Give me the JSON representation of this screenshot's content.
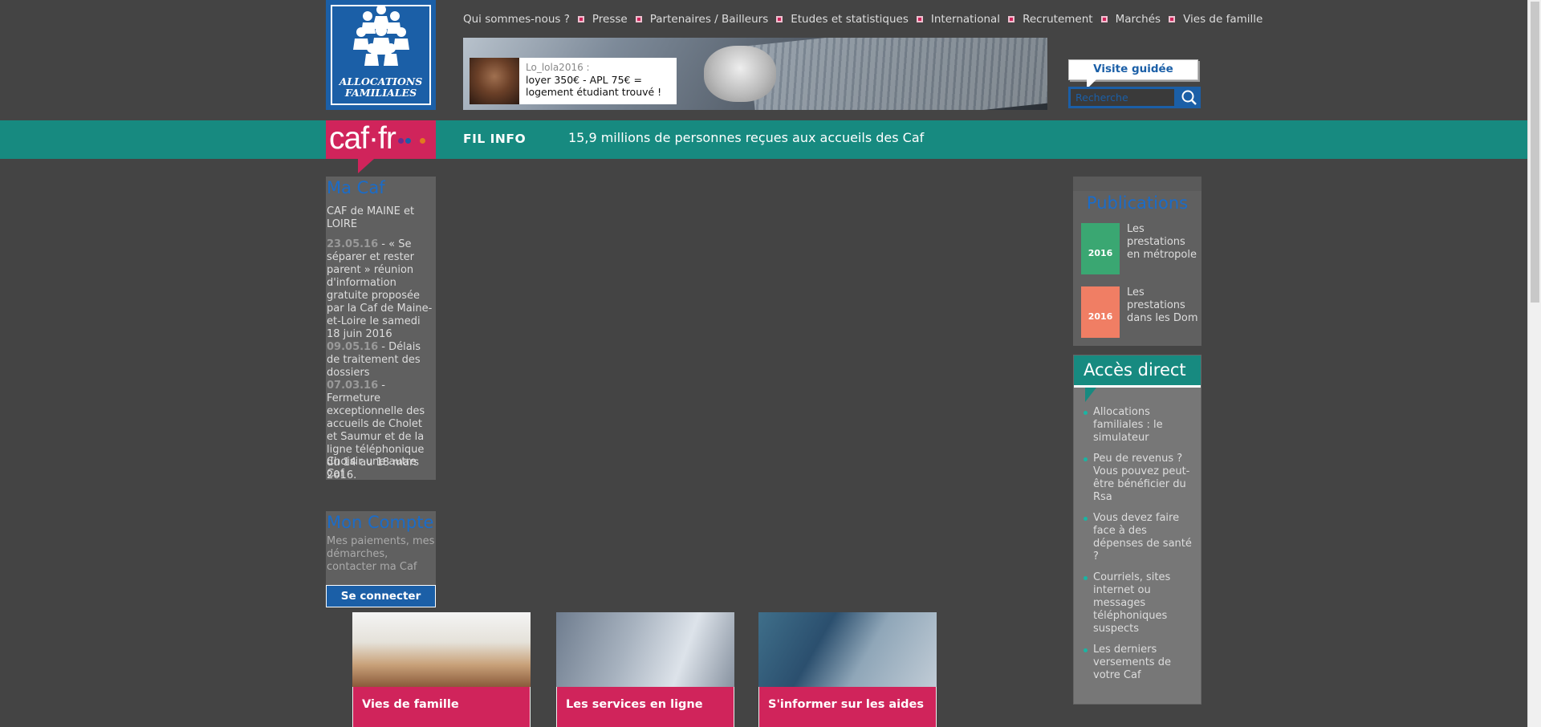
{
  "logo": {
    "line1": "ALLOCATIONS",
    "line2": "FAMILIALES"
  },
  "topnav": [
    "Qui sommes-nous ?",
    "Presse",
    "Partenaires / Bailleurs",
    "Etudes et statistiques",
    "International",
    "Recrutement",
    "Marchés",
    "Vies de famille"
  ],
  "banner": {
    "user": "Lo_lola2016 :",
    "message": "loyer 350€ - APL 75€ = logement étudiant trouvé !"
  },
  "guided_tour": "Visite guidée",
  "search": {
    "placeholder": "Recherche"
  },
  "caf_logo": "caf·fr",
  "fil_info": {
    "label": "FIL INFO",
    "text": "15,9 millions de personnes reçues aux accueils des Caf"
  },
  "macaf": {
    "title": "Ma Caf",
    "caf_name": "CAF de MAINE et LOIRE",
    "news": [
      {
        "date": "23.05.16",
        "text": " - « Se séparer et rester parent » réunion d'information gratuite proposée par la Caf de Maine-et-Loire le samedi 18 juin 2016"
      },
      {
        "date": "09.05.16",
        "text": " - Délais de traitement des dossiers"
      },
      {
        "date": "07.03.16",
        "text": " - Fermeture exceptionnelle des accueils de Cholet et Saumur et de la ligne téléphonique du 14 au 18 mars 2016."
      }
    ],
    "other": "Choisir une autre Caf"
  },
  "compte": {
    "title": "Mon Compte",
    "desc": "Mes paiements, mes démarches, contacter ma Caf",
    "button": "Se connecter"
  },
  "tiles": [
    {
      "label": "Vies de famille"
    },
    {
      "label": "Les services en ligne"
    },
    {
      "label": "S'informer sur les aides"
    }
  ],
  "publications": {
    "title": "Publications",
    "items": [
      {
        "text": "Les prestations en métropole",
        "year": "2016",
        "color": "#3aa772"
      },
      {
        "text": "Les prestations dans les Dom",
        "year": "2016",
        "color": "#f07e64"
      }
    ]
  },
  "acces": {
    "title": "Accès direct",
    "items": [
      "Allocations familiales : le simulateur",
      "Peu de revenus ? Vous pouvez peut-être bénéficier du Rsa",
      "Vous devez faire face à des dépenses de santé ?",
      "Courriels, sites internet ou messages téléphoniques suspects",
      "Les derniers versements de votre Caf"
    ]
  },
  "colors": {
    "brand_blue": "#1b5fa7",
    "caf_pink": "#d0245b",
    "teal": "#178a80",
    "background": "#444444"
  }
}
